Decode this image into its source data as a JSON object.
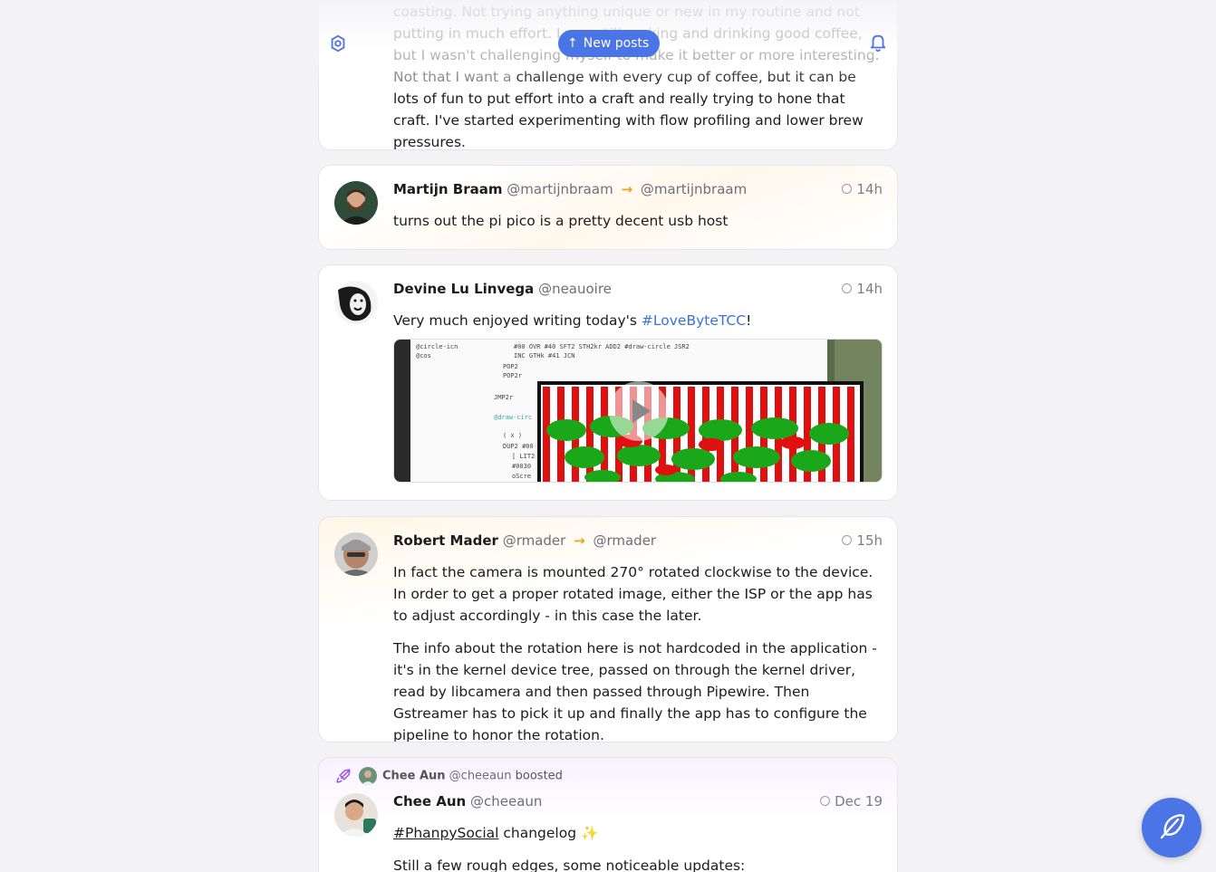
{
  "header": {
    "new_posts_label": "New posts",
    "new_posts_icon": "arrow-up-icon",
    "settings_icon": "gear-icon",
    "notifications_icon": "bell-icon"
  },
  "posts": [
    {
      "paragraphs_faded": [
        "coasting. Not trying anything unique or new in my routine and not putting in much effort. I was still making and drinking good coffee, but I wasn't challenging myself to make it better or more interesting. Not that I want a"
      ],
      "paragraphs": [
        "challenge with every cup of coffee, but it can be lots of fun to put effort into a craft and really trying to hone that craft. I've started experimenting with flow profiling and lower brew pressures."
      ]
    },
    {
      "name": "Martijn Braam",
      "handle": "@martijnbraam",
      "reply_arrow": "→",
      "reply_to": "@martijnbraam",
      "time": "14h",
      "text": "turns out the pi pico is a pretty decent usb host"
    },
    {
      "name": "Devine Lu Linvega",
      "handle": "@neauoire",
      "time": "14h",
      "text_before": "Very much enjoyed writing today's ",
      "hashtag": "#LoveByteTCC",
      "text_after": "!",
      "media_type": "video"
    },
    {
      "name": "Robert Mader",
      "handle": "@rmader",
      "reply_arrow": "→",
      "reply_to": "@rmader",
      "time": "15h",
      "paragraphs": [
        "In fact the camera is mounted 270° rotated clockwise to the device. In order to get a proper rotated image, either the ISP or the app has to adjust accordingly - in this case the later.",
        "The info about the rotation here is not hardcoded in the application - it's in the kernel device tree, passed on through the kernel driver, read by libcamera and then passed through Pipewire. Then Gstreamer has to pick it up and finally the app has to configure the pipeline to honor the rotation."
      ]
    },
    {
      "booster_name": "Chee Aun",
      "booster_handle": "@cheeaun",
      "boosted_label": "boosted",
      "name": "Chee Aun",
      "handle": "@cheeaun",
      "time": "Dec 19",
      "hashtag": "#PhanpySocial",
      "text_after": " changelog ✨",
      "text2": "Still a few rough edges, some noticeable updates:"
    }
  ],
  "compose_icon": "feather-icon",
  "colors": {
    "accent": "#4b74e6",
    "reply_arrow": "#f0a020",
    "hashtag": "#3b6fe0",
    "boost": "#9b4fe0"
  }
}
